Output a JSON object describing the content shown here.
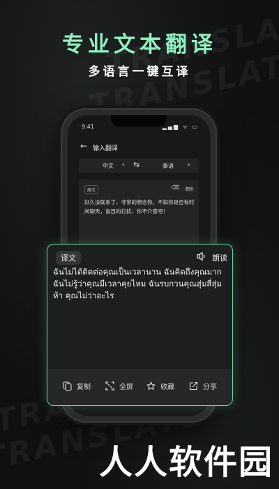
{
  "headline": "专业文本翻译",
  "subline": "多语言一键互译",
  "watermark_text": "TRANSLATE",
  "phone": {
    "status_time": "9:41",
    "status_icons": "▂▄▆ ᯤ ▭",
    "nav_title": "输入翻译",
    "lang_from": "中文",
    "lang_to": "泰语",
    "source_tag": "原文",
    "clear_label": "清除",
    "source_text": "好久没联系了，非常的想念你。不知你是否有时间聊天，盲目的打扰，你不介意吧！"
  },
  "translation_card": {
    "tag": "译文",
    "read_label": "朗读",
    "text": "ฉันไม่ได้ติดต่อคุณเป็นเวลานาน ฉันคิดถึงคุณมาก ฉันไม่รู้ว่าคุณมีเวลาคุยไหม ฉันรบกวนคุณสุ่มสี่สุ่มห้า คุณไม่ว่าอะไร",
    "tools": [
      {
        "label": "复制",
        "icon": "copy-icon"
      },
      {
        "label": "全屏",
        "icon": "fullscreen-icon"
      },
      {
        "label": "收藏",
        "icon": "star-icon"
      },
      {
        "label": "分享",
        "icon": "share-icon"
      }
    ]
  },
  "brand": "人人软件园",
  "colors": {
    "accent": "#8ff0c2",
    "card_border": "#6fd6a4",
    "background": "#0f1010"
  }
}
